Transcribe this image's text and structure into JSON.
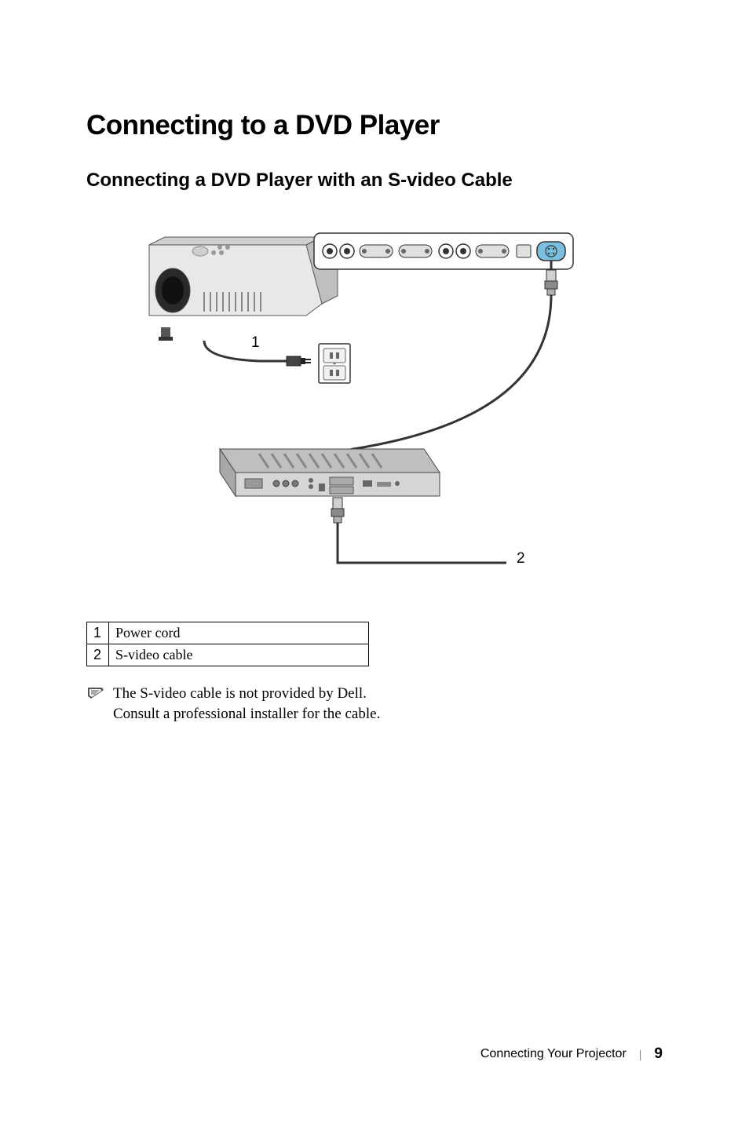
{
  "headings": {
    "main": "Connecting to a DVD Player",
    "sub": "Connecting a DVD Player with an S-video Cable"
  },
  "diagram": {
    "callouts": {
      "1": "1",
      "2": "2"
    }
  },
  "legend": {
    "rows": [
      {
        "num": "1",
        "label": "Power cord"
      },
      {
        "num": "2",
        "label": "S-video cable"
      }
    ]
  },
  "note": {
    "line1": "The S-video cable is not provided by Dell.",
    "line2": "Consult a professional installer for the cable."
  },
  "footer": {
    "section": "Connecting Your Projector",
    "page": "9"
  }
}
